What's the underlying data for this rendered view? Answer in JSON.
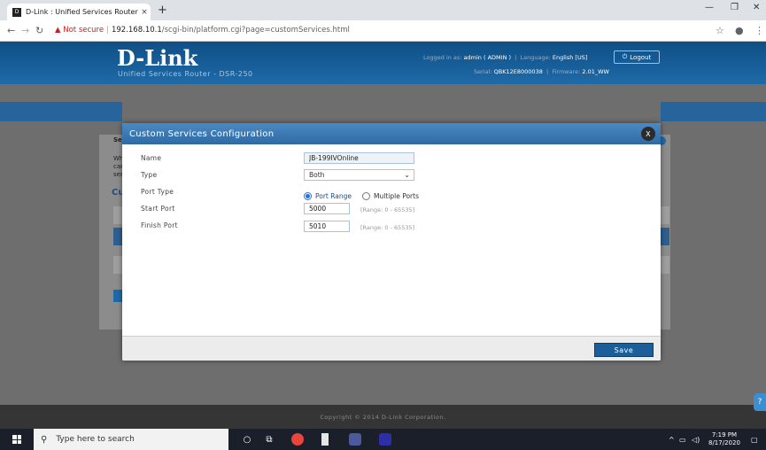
{
  "browser": {
    "tab_title": "D-Link : Unified Services Router",
    "tab_close": "×",
    "new_tab": "+",
    "win_min": "—",
    "win_max": "❐",
    "win_close": "✕",
    "security_label": "▲ Not secure",
    "url_host": "192.168.10.1",
    "url_path": "/scgi-bin/platform.cgi?page=customServices.html"
  },
  "header": {
    "logo": "D-Link",
    "subtitle": "Unified Services Router - DSR-250",
    "logged_in_label": "Logged in as:",
    "logged_in_value": "admin ( ADMIN )",
    "language_label": "Language:",
    "language_value": "English [US]",
    "serial_label": "Serial:",
    "serial_value": "QBK12E8000038",
    "firmware_label": "Firmware:",
    "firmware_value": "2.01_WW",
    "logout_label": "Logout"
  },
  "background": {
    "sec_label": "Sec",
    "wh_text": "Wh",
    "can_text": "can",
    "ser_text": "ser",
    "cu_label": "Cu"
  },
  "modal": {
    "title": "Custom Services Configuration",
    "close_label": "X",
    "fields": {
      "name_label": "Name",
      "name_value": "JB-199IVOnline",
      "type_label": "Type",
      "type_value": "Both",
      "port_type_label": "Port Type",
      "port_range_label": "Port Range",
      "multiple_ports_label": "Multiple Ports",
      "start_port_label": "Start Port",
      "start_port_value": "5000",
      "start_port_range": "[Range: 0 - 65535]",
      "finish_port_label": "Finish Port",
      "finish_port_value": "5010",
      "finish_port_range": "[Range: 0 - 65535]"
    },
    "save_label": "Save"
  },
  "footer": {
    "copyright": "Copyright © 2014 D-Link Corporation."
  },
  "taskbar": {
    "search_placeholder": "Type here to search",
    "time": "7:19 PM",
    "date": "8/17/2020"
  }
}
